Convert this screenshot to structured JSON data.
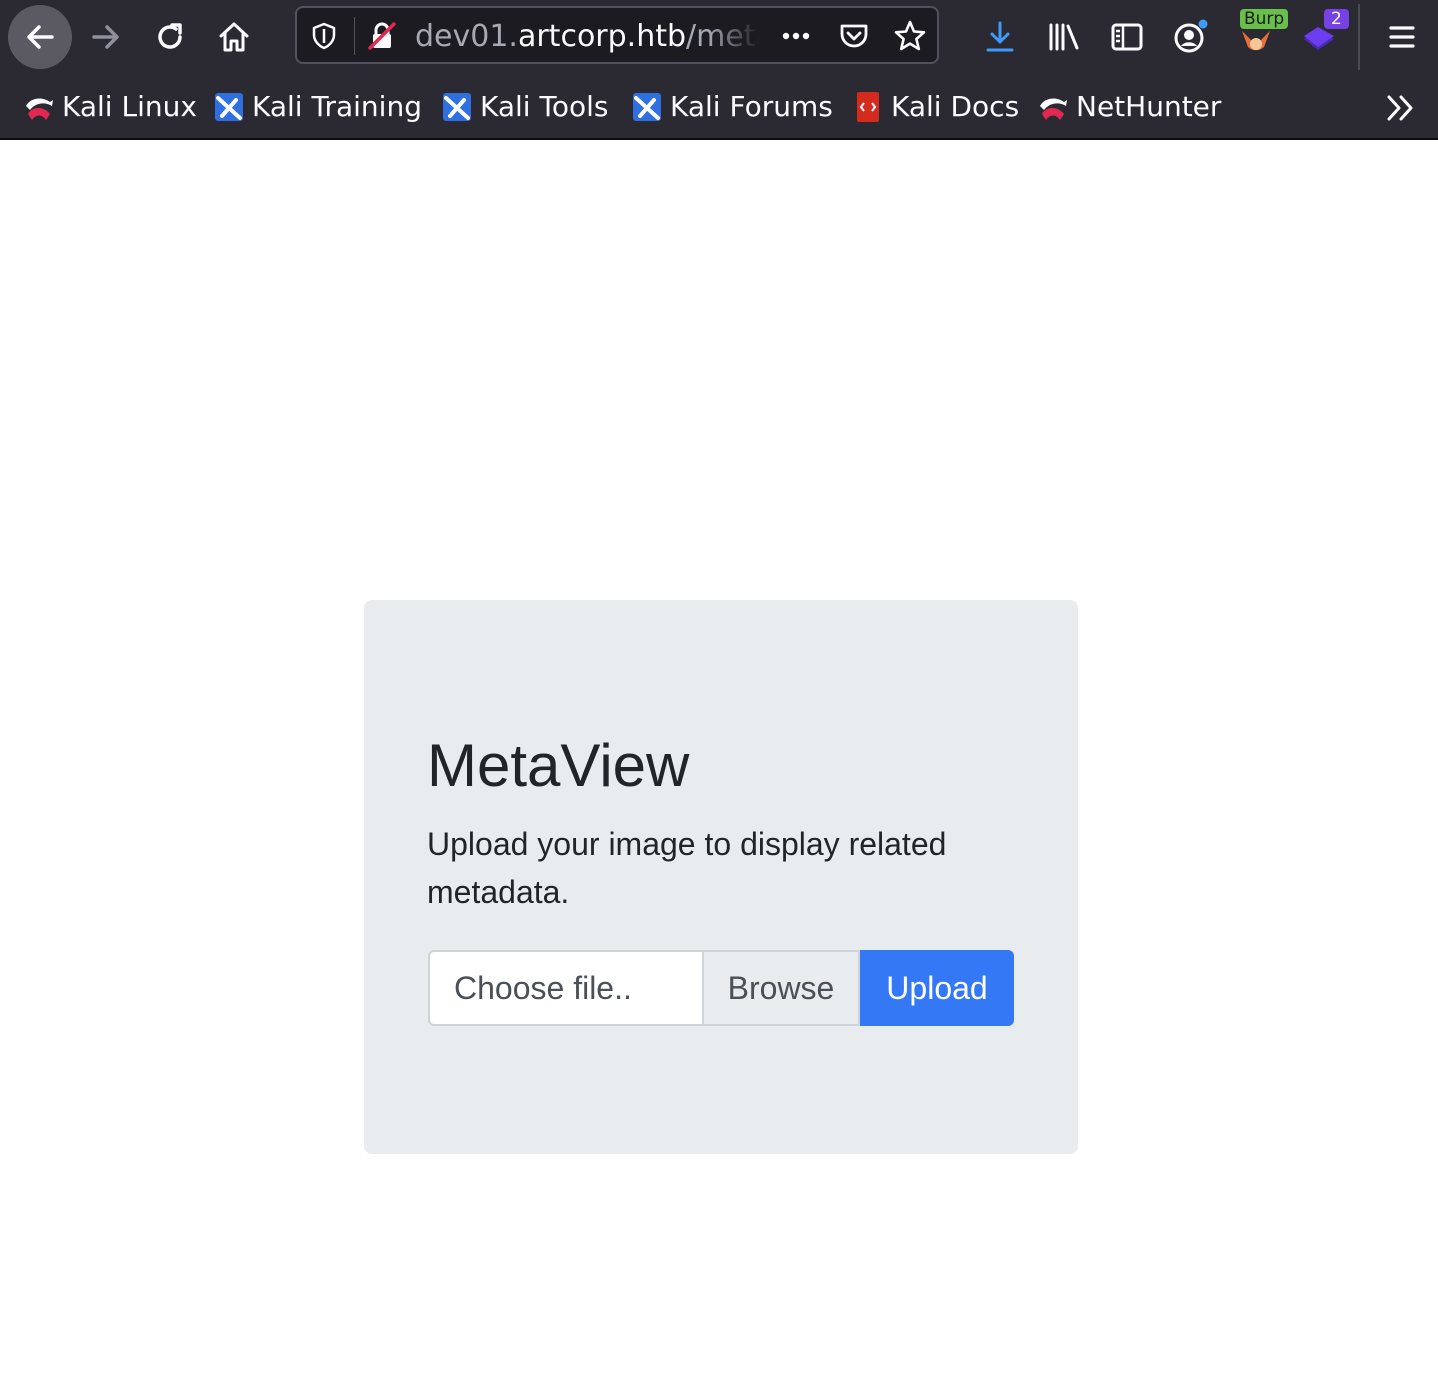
{
  "browser": {
    "url": {
      "subdomain": "dev01.",
      "domain": "artcorp.htb",
      "path": "/metavi"
    },
    "toolbar_badges": {
      "burp": "Burp",
      "extension_count": "2"
    },
    "nav_icons": [
      "back-arrow-icon",
      "forward-arrow-icon",
      "reload-icon",
      "home-icon"
    ],
    "urlbar_icons": [
      "tracking-shield-icon",
      "insecure-connection-icon",
      "page-actions-icon",
      "pocket-icon",
      "bookmark-star-icon"
    ],
    "toolbar_icons": [
      "downloads-icon",
      "library-icon",
      "sidebar-icon",
      "account-icon",
      "foxyproxy-icon",
      "extension-icon",
      "menu-icon"
    ],
    "accent_color": "#3478f6"
  },
  "bookmarks": [
    {
      "label": "Kali Linux",
      "icon": "kali-dragon-icon"
    },
    {
      "label": "Kali Training",
      "icon": "kali-training-icon"
    },
    {
      "label": "Kali Tools",
      "icon": "kali-tools-icon"
    },
    {
      "label": "Kali Forums",
      "icon": "kali-forums-icon"
    },
    {
      "label": "Kali Docs",
      "icon": "kali-docs-icon"
    },
    {
      "label": "NetHunter",
      "icon": "nethunter-icon"
    }
  ],
  "page": {
    "title": "MetaView",
    "lead": "Upload your image to display related metadata.",
    "file_input_label": "Choose file..",
    "browse_label": "Browse",
    "upload_label": "Upload",
    "upload_color": "#3478f6"
  }
}
